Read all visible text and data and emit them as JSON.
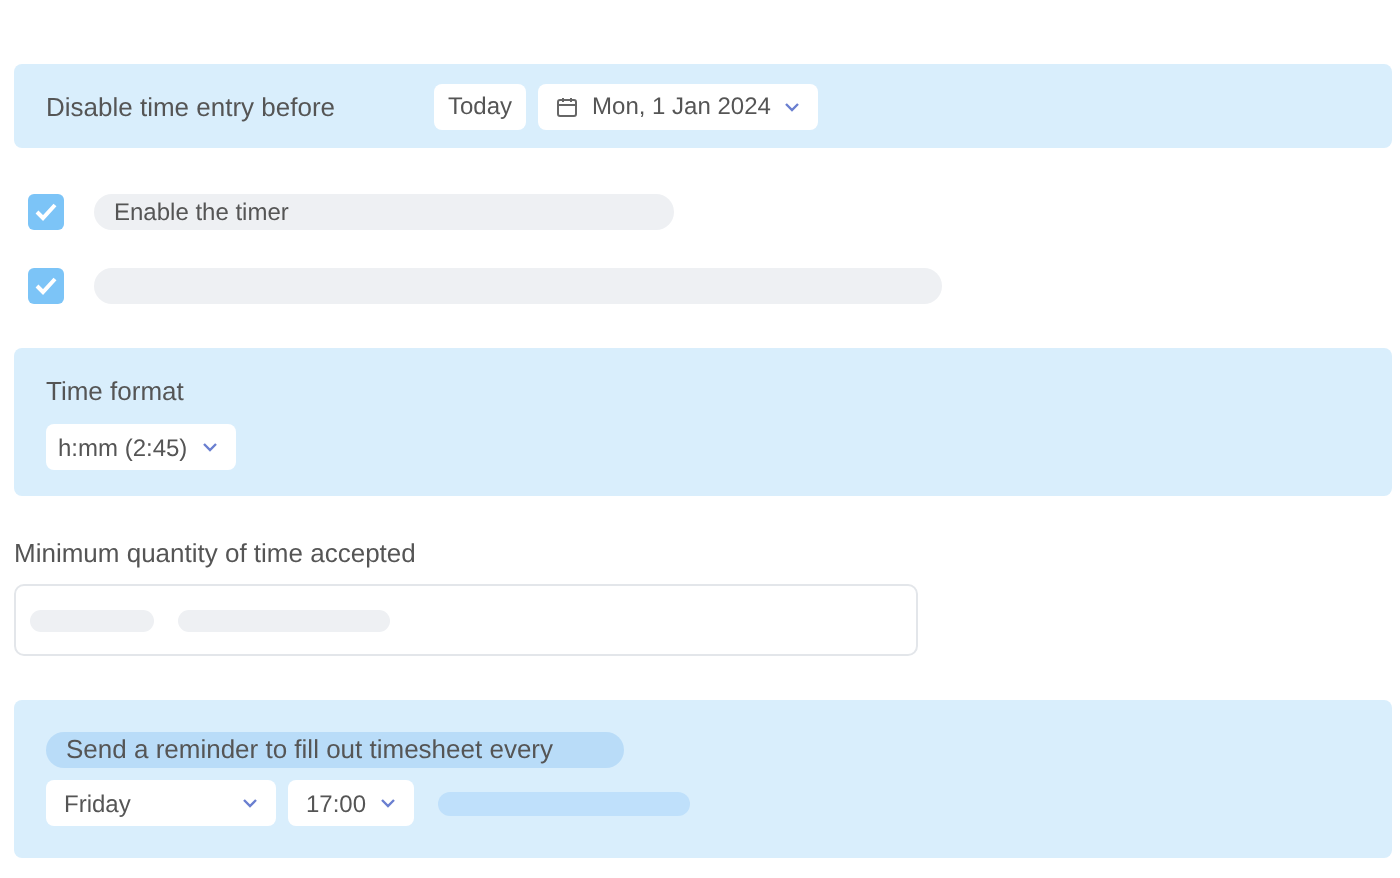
{
  "date_row": {
    "label": "Disable time entry before",
    "today_button": "Today",
    "date_select": {
      "value": "Mon, 1 Jan 2024"
    }
  },
  "options": [
    {
      "label": "Enable the timer",
      "checked": true
    },
    {
      "checked": true
    }
  ],
  "time_format": {
    "label": "Time format",
    "select": {
      "value": "h:mm (2:45)"
    }
  },
  "minimum_time": {
    "label": "Minimum quantity of time accepted"
  },
  "reminder": {
    "label": "Send a reminder to fill out timesheet every",
    "day_select": {
      "value": "Friday"
    },
    "time_select": {
      "value": "17:00"
    }
  }
}
